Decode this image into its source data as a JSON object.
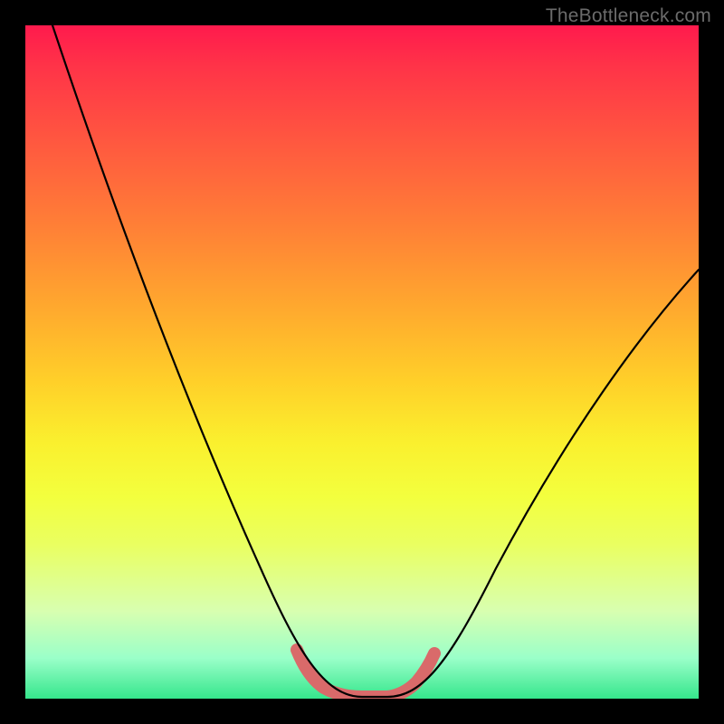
{
  "attribution": "TheBottleneck.com",
  "chart_data": {
    "type": "line",
    "title": "",
    "xlabel": "",
    "ylabel": "",
    "xlim": [
      0,
      100
    ],
    "ylim": [
      0,
      100
    ],
    "series": [
      {
        "name": "bottleneck-curve",
        "x": [
          0,
          5,
          10,
          15,
          20,
          25,
          30,
          35,
          40,
          42,
          44,
          46,
          48,
          50,
          52,
          55,
          60,
          65,
          70,
          75,
          80,
          85,
          90,
          95,
          100
        ],
        "values": [
          100,
          90,
          80,
          70,
          60,
          49,
          37,
          25,
          12,
          6,
          2,
          0,
          0,
          0,
          2,
          6,
          13,
          20,
          27,
          34,
          41,
          47,
          53,
          59,
          64
        ]
      },
      {
        "name": "highlight-band",
        "x": [
          40,
          42,
          44,
          46,
          48,
          50,
          52,
          54
        ],
        "values": [
          7,
          3,
          1,
          0,
          0,
          1,
          3,
          7
        ]
      }
    ],
    "colors": {
      "curve": "#000000",
      "highlight": "#d96a6a"
    }
  }
}
